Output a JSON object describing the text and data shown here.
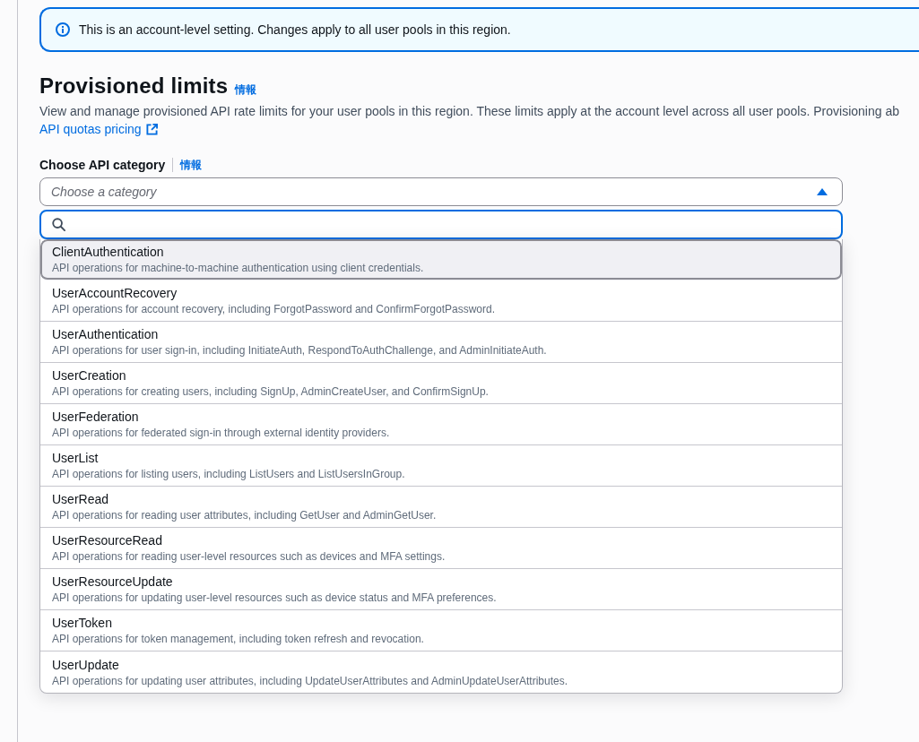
{
  "alert": {
    "text": "This is an account-level setting. Changes apply to all user pools in this region."
  },
  "section": {
    "title": "Provisioned limits",
    "info_link": "情報",
    "description": "View and manage provisioned API rate limits for your user pools in this region. These limits apply at the account level across all user pools. Provisioning ab",
    "link": "API quotas pricing"
  },
  "category_field": {
    "label": "Choose API category",
    "info_link": "情報",
    "placeholder": "Choose a category",
    "expanded": true,
    "options": [
      {
        "label": "ClientAuthentication",
        "description": "API operations for machine-to-machine authentication using client credentials.",
        "highlighted": true,
        "selected": false
      },
      {
        "label": "UserAccountRecovery",
        "description": "API operations for account recovery, including ForgotPassword and ConfirmForgotPassword.",
        "highlighted": false,
        "selected": false
      },
      {
        "label": "UserAuthentication",
        "description": "API operations for user sign-in, including InitiateAuth, RespondToAuthChallenge, and AdminInitiateAuth.",
        "highlighted": false,
        "selected": false
      },
      {
        "label": "UserCreation",
        "description": "API operations for creating users, including SignUp, AdminCreateUser, and ConfirmSignUp.",
        "highlighted": false,
        "selected": false
      },
      {
        "label": "UserFederation",
        "description": "API operations for federated sign-in through external identity providers.",
        "highlighted": false,
        "selected": false
      },
      {
        "label": "UserList",
        "description": "API operations for listing users, including ListUsers and ListUsersInGroup.",
        "highlighted": false,
        "selected": false
      },
      {
        "label": "UserRead",
        "description": "API operations for reading user attributes, including GetUser and AdminGetUser.",
        "highlighted": false,
        "selected": false
      },
      {
        "label": "UserResourceRead",
        "description": "API operations for reading user-level resources such as devices and MFA settings.",
        "highlighted": false,
        "selected": false
      },
      {
        "label": "UserResourceUpdate",
        "description": "API operations for updating user-level resources such as device status and MFA preferences.",
        "highlighted": false,
        "selected": false
      },
      {
        "label": "UserToken",
        "description": "API operations for token management, including token refresh and revocation.",
        "highlighted": false,
        "selected": false
      },
      {
        "label": "UserUpdate",
        "description": "API operations for updating user attributes, including UpdateUserAttributes and AdminUpdateUserAttributes.",
        "highlighted": false,
        "selected": false
      }
    ]
  }
}
